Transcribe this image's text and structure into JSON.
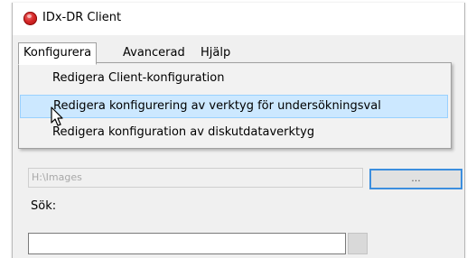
{
  "window": {
    "title": "IDx-DR Client"
  },
  "menubar": {
    "items": [
      {
        "label": "Konfigurera",
        "open": true
      },
      {
        "label": "Avancerad",
        "open": false
      },
      {
        "label": "Hjälp",
        "open": false
      }
    ]
  },
  "dropdown": {
    "items": [
      {
        "label": "Redigera Client-konfiguration",
        "hovered": false
      },
      {
        "label": "Redigera konfigurering av verktyg för undersökningsval",
        "hovered": true
      },
      {
        "label": "Redigera konfiguration av diskutdataverktyg",
        "hovered": false
      }
    ]
  },
  "path": {
    "value": "H:\\Images"
  },
  "browse_button": {
    "label": "..."
  },
  "search": {
    "label": "Sök:",
    "value": "",
    "placeholder": ""
  },
  "icons": {
    "app": "app-logo-icon",
    "cursor": "mouse-pointer-icon",
    "search": "search-icon"
  },
  "colors": {
    "menu_hover_bg": "#cce8ff",
    "menu_hover_border": "#99d1ff",
    "focus_border": "#3c8ede",
    "app_icon": "#d42626"
  }
}
